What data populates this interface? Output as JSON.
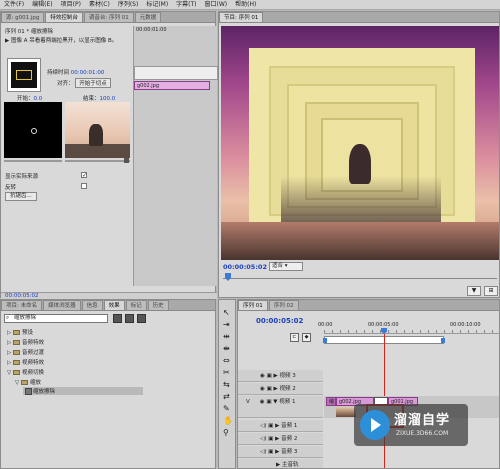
{
  "menu": [
    "文件(F)",
    "编辑(E)",
    "项目(P)",
    "素材(C)",
    "序列(S)",
    "标记(M)",
    "字幕(T)",
    "窗口(W)",
    "帮助(H)"
  ],
  "top_left_tabs": [
    "源: g001.jpg",
    "特效控制台",
    "调音台: 序列 01",
    "元数据"
  ],
  "program_tab": "节目: 序列 01",
  "effect_controls": {
    "sequence_clip": "序列 01 * 缩放擦除",
    "mini_time": "00:00:01:00",
    "clip_label": "g002.jpg",
    "description": "图像 A 吊看着两端拉黑开，以显示图像 B。",
    "duration_label": "持续时间",
    "duration_value": "00:00:01:00",
    "align_label": "对齐：",
    "align_value": "开始于切点",
    "start_label": "开始：",
    "start_value": "0.0",
    "end_label": "结束：",
    "end_value": "100.0",
    "show_source_label": "显示实际来源",
    "reverse_label": "反转",
    "antialias_label": "抗锯齿...",
    "bottom_time": "00:00:05:02"
  },
  "program_monitor": {
    "timecode": "00:00:05:02",
    "fit_value": "适合"
  },
  "project_tabs": [
    "项目: 未命名",
    "媒体浏览器",
    "信息",
    "效果",
    "标记",
    "历史"
  ],
  "effects_panel": {
    "search_value": "缩放擦除",
    "tree": [
      "预设",
      "音频特效",
      "音频过渡",
      "视频特效",
      "视频切换",
      "缩放",
      "缩放擦除"
    ]
  },
  "timeline": {
    "tabs": [
      "序列 01",
      "序列 02"
    ],
    "timecode": "00:00:05:02",
    "ruler": [
      "00:00",
      "00:00:05:00",
      "00:00:10:00"
    ],
    "tracks_video": [
      "视频 3",
      "视频 2",
      "视频 1"
    ],
    "tracks_audio": [
      "音频 1",
      "音频 2",
      "音频 3",
      "主音轨"
    ],
    "track_side_label": "V",
    "clips": [
      "g002.jpg",
      "g001.jpg",
      "缩"
    ]
  },
  "watermark": {
    "brand": "溜溜自学",
    "url": "ZIXUE.3D66.COM"
  },
  "colors": {
    "accent_blue": "#1b3fc2",
    "clip_pink": "#d79ad6",
    "highlight_red": "#d4251f"
  }
}
